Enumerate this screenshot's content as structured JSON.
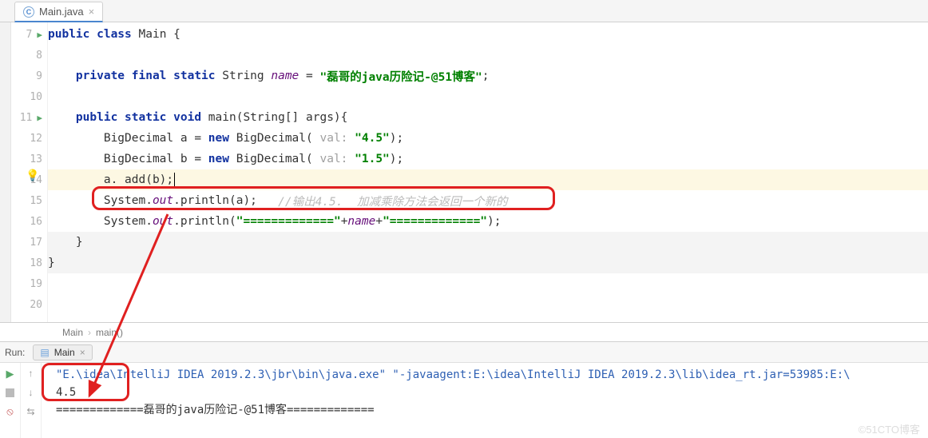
{
  "tab": {
    "filename": "Main.java",
    "icon_letter": "C"
  },
  "gutter": {
    "lines": [
      "7",
      "8",
      "9",
      "10",
      "11",
      "12",
      "13",
      "14",
      "15",
      "16",
      "17",
      "18",
      "19",
      "20"
    ],
    "run_markers": [
      0,
      4
    ]
  },
  "code": {
    "l7": {
      "pre": "",
      "kw1": "public class ",
      "type": "Main ",
      "brace": "{"
    },
    "l9": {
      "indent": "    ",
      "kw": "private final static ",
      "type": "String ",
      "name": "name",
      "eq": " = ",
      "str": "\"磊哥的java历险记-@51博客\"",
      "semi": ";"
    },
    "l11": {
      "indent": "    ",
      "kw": "public static void ",
      "fn": "main(String[] args){"
    },
    "l12": {
      "indent": "        ",
      "t1": "BigDecimal a = ",
      "kw": "new ",
      "t2": "BigDecimal(",
      "hint": " val: ",
      "str": "\"4.5\"",
      "t3": ");"
    },
    "l13": {
      "indent": "        ",
      "t1": "BigDecimal b = ",
      "kw": "new ",
      "t2": "BigDecimal(",
      "hint": " val: ",
      "str": "\"1.5\"",
      "t3": ");"
    },
    "l14": {
      "indent": "        ",
      "t": "a. add(b);"
    },
    "l15": {
      "indent": "        ",
      "t1": "System.",
      "it": "out",
      "t2": ".println(a);   ",
      "comment": "//输出4.5.  加减乘除方法会返回一个新的"
    },
    "l16": {
      "indent": "        ",
      "t1": "System.",
      "it": "out",
      "t2": ".println(",
      "str1": "\"=============\"",
      "plus1": "+",
      "name": "name",
      "plus2": "+",
      "str2": "\"=============\"",
      "t3": ");"
    },
    "l17": {
      "indent": "    ",
      "brace": "}"
    },
    "l18": {
      "indent": "",
      "brace": "}"
    }
  },
  "breadcrumb": {
    "a": "Main",
    "b": "main()"
  },
  "run": {
    "title": "Run:",
    "tab_label": "Main",
    "lines": {
      "path": "\"E.\\idea\\IntelliJ IDEA 2019.2.3\\jbr\\bin\\java.exe\" \"-javaagent:E:\\idea\\IntelliJ IDEA 2019.2.3\\lib\\idea_rt.jar=53985:E:\\",
      "out1": "4.5",
      "out2": "=============磊哥的java历险记-@51博客============="
    }
  },
  "watermark": "©51CTO博客"
}
